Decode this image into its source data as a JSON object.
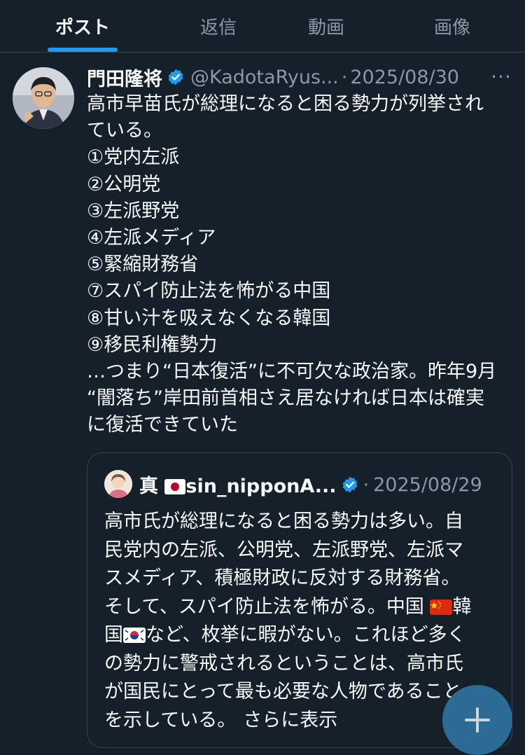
{
  "tabs": [
    {
      "label": "ポスト",
      "active": true
    },
    {
      "label": "返信",
      "active": false
    },
    {
      "label": "動画",
      "active": false
    },
    {
      "label": "画像",
      "active": false
    }
  ],
  "post": {
    "author_name": "門田隆将",
    "handle": "@KadotaRyus...",
    "separator": "·",
    "date": "2025/08/30",
    "more_icon": "···",
    "lines": [
      "高市早苗氏が総理になると困る勢力が列挙され",
      "ている。",
      "①党内左派",
      "②公明党",
      "③左派野党",
      "④左派メディア",
      "⑤緊縮財務省",
      "⑦スパイ防止法を怖がる中国",
      "⑧甘い汁を吸えなくなる韓国",
      "⑨移民利権勢力",
      "…つまり“日本復活”に不可欠な政治家。昨年9月",
      "“闇落ち”岸田前首相さえ居なければ日本は確実",
      "に復活できていた"
    ]
  },
  "quote": {
    "author_prefix": "真",
    "author_suffix": "sin_nipponA...",
    "separator": "·",
    "date": "2025/08/29",
    "lines": [
      "高市氏が総理になると困る勢力は多い。自",
      "民党内の左派、公明党、左派野党、左派マ",
      "スメディア、積極財政に反対する財務省。"
    ],
    "line4_text": "そして、スパイ防止法を怖がる。中国",
    "line4_tail": "韓",
    "line5_head": "国",
    "line5_text": "など、枚挙に暇がない。これほど多く",
    "lines_after": [
      "の勢力に警戒されるということは、高市氏",
      "が国民にとって最も必要な人物であること"
    ],
    "last_line": "を示している。",
    "show_more": "さらに表示"
  },
  "colors": {
    "background": "#15202b",
    "accent": "#1d9bf0",
    "text": "#f7f9f9",
    "muted": "#8b98a5",
    "border": "#38444d"
  },
  "icons": [
    "verified-badge-icon",
    "more-icon",
    "japan-flag-icon",
    "china-flag-icon",
    "korea-flag-icon",
    "compose-plus-icon"
  ]
}
